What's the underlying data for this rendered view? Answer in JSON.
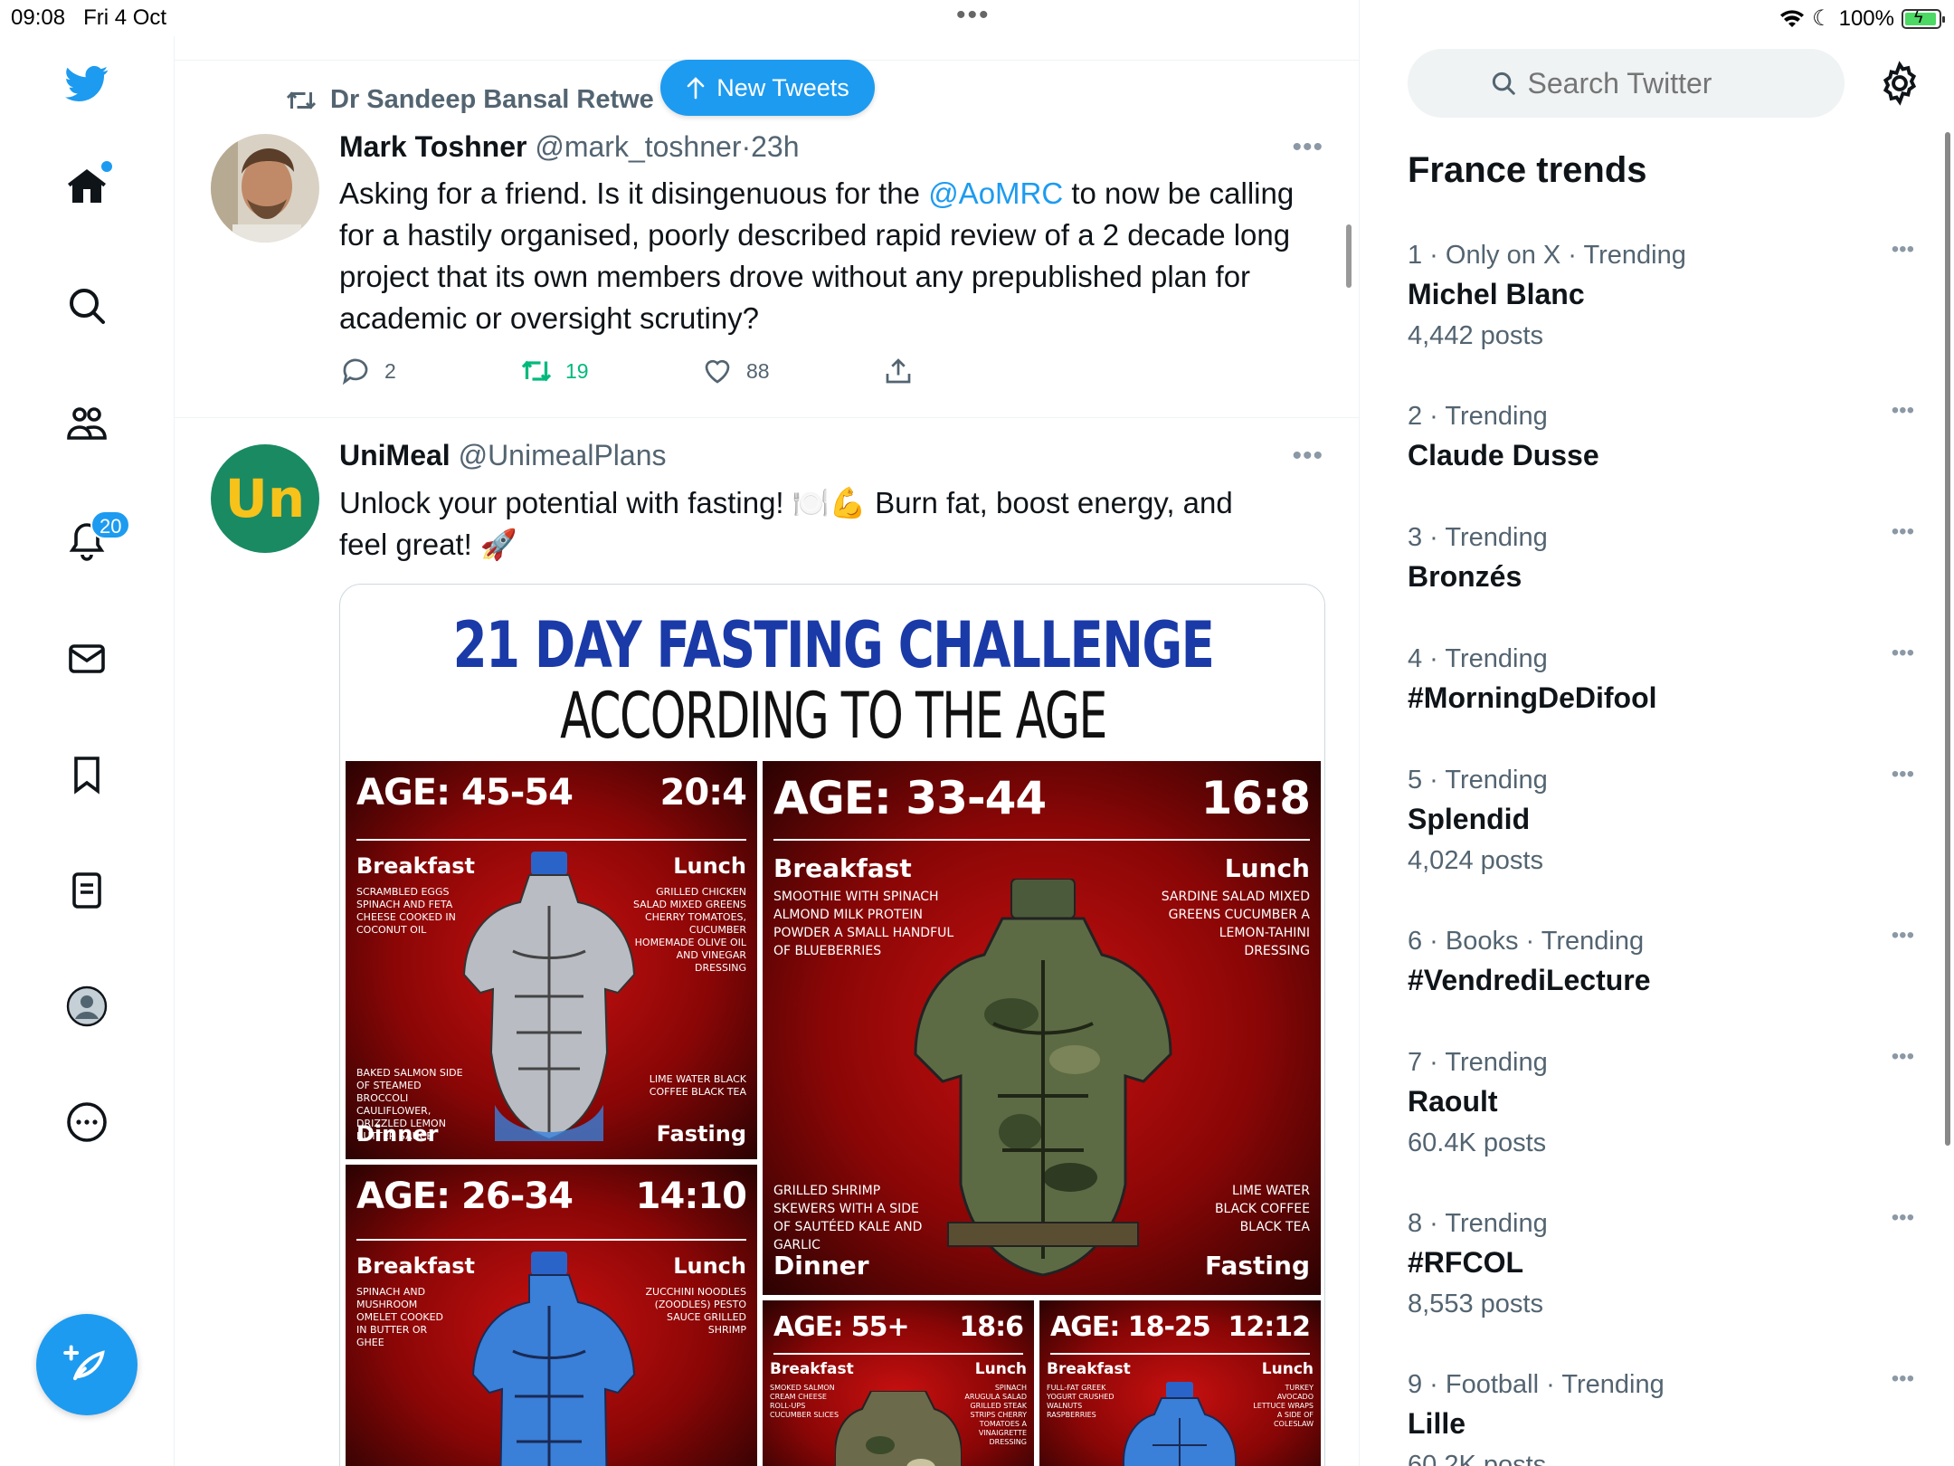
{
  "status": {
    "time": "09:08",
    "date": "Fri 4 Oct",
    "battery": "100%"
  },
  "nav": {
    "notifications_badge": "20"
  },
  "new_tweets": {
    "label": "New Tweets"
  },
  "tweet1": {
    "retweeted_by": "Dr Sandeep Bansal Retwe",
    "name": "Mark Toshner",
    "handle": "@mark_toshner",
    "time": "23h",
    "text_before": "Asking for a friend. Is it disingenuous for the ",
    "mention": "@AoMRC",
    "text_after": " to now be calling for a hastily organised, poorly described rapid review of a 2 decade long project that its own members drove without any prepublished plan for academic or oversight scrutiny?",
    "replies": "2",
    "retweets": "19",
    "likes": "88"
  },
  "tweet2": {
    "name": "UniMeal",
    "handle": "@UnimealPlans",
    "avatar_text": "Un",
    "text_line1": "Unlock your potential with fasting! 🍽️💪 Burn fat, boost energy, and",
    "text_line2": "feel great! 🚀",
    "media": {
      "title": "21 DAY FASTING CHALLENGE",
      "subtitle": "ACCORDING TO THE AGE",
      "panels": [
        {
          "age": "AGE: 45-54",
          "ratio": "20:4",
          "breakfast": "Breakfast",
          "lunch": "Lunch",
          "dinner": "Dinner",
          "fasting": "Fasting",
          "breakfast_items": "Scrambled eggs spinach and feta cheese cooked in coconut oil",
          "lunch_items": "Grilled chicken salad mixed greens cherry tomatoes, cucumber homemade olive oil and vinegar dressing",
          "dinner_items": "Baked salmon side of steamed broccoli cauliflower, drizzled lemon butter sauce",
          "fasting_items": "Lime water black coffee black tea"
        },
        {
          "age": "AGE: 33-44",
          "ratio": "16:8",
          "breakfast": "Breakfast",
          "lunch": "Lunch",
          "dinner": "Dinner",
          "fasting": "Fasting",
          "breakfast_items": "Smoothie with spinach almond milk protein powder a small handful of blueberries",
          "lunch_items": "Sardine salad mixed greens cucumber a lemon-tahini dressing",
          "dinner_items": "Grilled shrimp skewers with a side of sautéed kale and garlic",
          "fasting_items": "Lime water black coffee black tea"
        },
        {
          "age": "AGE: 26-34",
          "ratio": "14:10",
          "breakfast": "Breakfast",
          "lunch": "Lunch",
          "breakfast_items": "Spinach and mushroom omelet cooked in butter or ghee",
          "lunch_items": "Zucchini noodles (zoodles) pesto sauce grilled shrimp"
        },
        {
          "age": "AGE: 55+",
          "ratio": "18:6",
          "breakfast": "Breakfast",
          "lunch": "Lunch",
          "breakfast_items": "Smoked salmon cream cheese roll-ups cucumber slices",
          "lunch_items": "Spinach arugula salad grilled steak strips cherry tomatoes a vinaigrette dressing"
        },
        {
          "age": "AGE: 18-25",
          "ratio": "12:12",
          "breakfast": "Breakfast",
          "lunch": "Lunch",
          "breakfast_items": "Full-fat greek yogurt crushed walnuts raspberries",
          "lunch_items": "Turkey avocado lettuce wraps a side of coleslaw"
        }
      ]
    }
  },
  "search": {
    "placeholder": "Search Twitter"
  },
  "trends": {
    "title": "France trends",
    "items": [
      {
        "meta": "1 · Only on X · Trending",
        "name": "Michel Blanc",
        "posts": "4,442 posts"
      },
      {
        "meta": "2 · Trending",
        "name": "Claude Dusse",
        "posts": ""
      },
      {
        "meta": "3 · Trending",
        "name": "Bronzés",
        "posts": ""
      },
      {
        "meta": "4 · Trending",
        "name": "#MorningDeDifool",
        "posts": ""
      },
      {
        "meta": "5 · Trending",
        "name": "Splendid",
        "posts": "4,024 posts"
      },
      {
        "meta": "6 · Books · Trending",
        "name": "#VendrediLecture",
        "posts": ""
      },
      {
        "meta": "7 · Trending",
        "name": "Raoult",
        "posts": "60.4K posts"
      },
      {
        "meta": "8 · Trending",
        "name": "#RFCOL",
        "posts": "8,553 posts"
      },
      {
        "meta": "9 · Football · Trending",
        "name": "Lille",
        "posts": "60.2K posts"
      }
    ]
  },
  "colors": {
    "accent": "#1d9bf0",
    "retweet": "#00ba7c",
    "muted": "#536471"
  }
}
